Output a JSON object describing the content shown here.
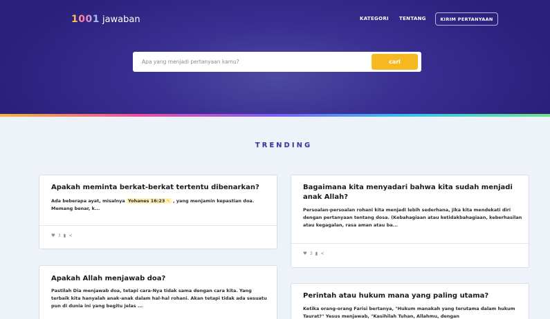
{
  "header": {
    "logo_number": "1001",
    "logo_word": "jawaban",
    "nav": [
      {
        "label": "KATEGORI"
      },
      {
        "label": "TENTANG"
      }
    ],
    "cta_label": "KIRIM PERTANYAAN"
  },
  "search": {
    "placeholder": "Apa yang menjadi pertanyaan kamu?",
    "button_label": "cari"
  },
  "section_title": "TRENDING",
  "cards": [
    {
      "title": "Apakah meminta berkat-berkat tertentu dibenarkan?",
      "text_before": "Ada beberapa ayat, misalnya ",
      "highlight": "Yohanes 16:23",
      "text_after": " , yang menjamin kepastian doa. Memang benar, k...",
      "likes": "3"
    },
    {
      "title": "Bagaimana kita menyadari bahwa kita sudah menjadi anak Allah?",
      "text": "Persoalan-persoalan rohani kita menjadi lebih sederhana, jika kita mendekati diri dengan pertanyaan tentang dosa. (Kebahagiaan atau ketidakbahagiaan, keberhasilan atau kegagalan, rasa aman atau ba...",
      "likes": "3"
    },
    {
      "title": "Apakah Allah menjawab doa?",
      "text": "Pastilah Dia menjawab doa, tetapi cara-Nya tidak sama dengan cara kita. Yang terbaik kita hanyalah anak-anak dalam hal-hal rohani. Akan tetapi tidak ada sesuatu pun di dunia ini yang begitu jelas ..."
    },
    {
      "title": "Perintah atau hukum mana yang paling utama?",
      "text": "Ketika orang-orang Farisi bertanya, \"Hukum manakah yang terutama dalam hukum Taurat?\" Yesus menjawab, \"Kasihilah Tuhan, Allahmu, dengan"
    }
  ],
  "icons": {
    "heart": "heart-icon",
    "bookmark": "bookmark-icon",
    "share": "share-icon",
    "highlight": "pencil-icon"
  },
  "colors": {
    "accent": "#f6b921",
    "hero": "#3a2f92",
    "trending": "#3b3b9e"
  }
}
